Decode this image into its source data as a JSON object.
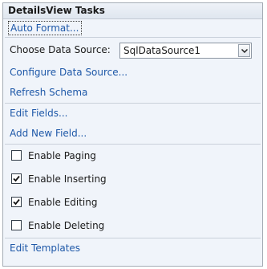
{
  "panel": {
    "title": "DetailsView Tasks"
  },
  "actions": {
    "auto_format": "Auto Format...",
    "configure_data_source": "Configure Data Source...",
    "refresh_schema": "Refresh Schema",
    "edit_fields": "Edit Fields...",
    "add_new_field": "Add New Field...",
    "edit_templates": "Edit Templates"
  },
  "data_source": {
    "label": "Choose Data Source:",
    "selected": "SqlDataSource1"
  },
  "options": [
    {
      "label": "Enable Paging",
      "checked": false
    },
    {
      "label": "Enable Inserting",
      "checked": true
    },
    {
      "label": "Enable Editing",
      "checked": true
    },
    {
      "label": "Enable Deleting",
      "checked": false
    }
  ],
  "colors": {
    "link": "#1e58a8",
    "panel_background": "#f0f4fa",
    "border": "#a5acb5"
  },
  "icons": {
    "dropdown": "chevron-down-icon",
    "check": "checkmark-icon"
  }
}
